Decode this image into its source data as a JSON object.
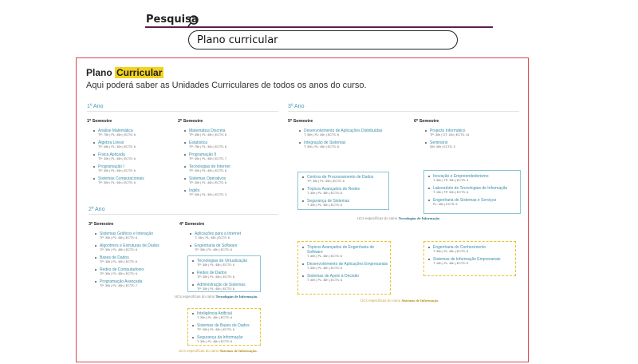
{
  "search": {
    "label": "Pesquisa",
    "value": "Plano curricular"
  },
  "page": {
    "title_plain": "Plano",
    "title_highlight": "Curricular",
    "subtitle": "Aqui poderá saber as Unidades Curriculares de todos os anos do curso."
  },
  "years": {
    "y1": "1º Ano",
    "y2": "2º Ano",
    "y3": "3º Ano"
  },
  "sem1": {
    "title": "1º Semestre",
    "items": [
      {
        "name": "Análise Matemática",
        "det": "TP: 75h | PL: 45h | ECTS: 6"
      },
      {
        "name": "Álgebra Linear",
        "det": "TP: 45h | PL: 30h | ECTS: 6"
      },
      {
        "name": "Física Aplicada",
        "det": "TP: 30h | PL: 45h | ECTS: 6"
      },
      {
        "name": "Programação I",
        "det": "TP: 30h | PL: 45h | ECTS: 6"
      },
      {
        "name": "Sistemas Computacionais",
        "det": "TP: 30h | PL: 45h | ECTS: 6"
      }
    ]
  },
  "sem2": {
    "title": "2º Semestre",
    "items": [
      {
        "name": "Matemática Discreta",
        "det": "TP: 45h | PL: 45h | ECTS: 6"
      },
      {
        "name": "Estatística",
        "det": "TP: 75h | PL: 30h | ECTS: 6"
      },
      {
        "name": "Programação II",
        "det": "TP: 30h | PL: 45h | ECTS: 7"
      },
      {
        "name": "Tecnologias de Internet",
        "det": "TP: 30h | PL: 45h | ECTS: 6"
      },
      {
        "name": "Sistemas Operativos",
        "det": "TP: 30h | PL: 45h | ECTS: 6"
      },
      {
        "name": "Inglês",
        "det": "TP: 30h | PL: 30h | ECTS: 3"
      }
    ]
  },
  "sem3": {
    "title": "3º Semestre",
    "items": [
      {
        "name": "Sistemas Gráficos e Interação",
        "det": "TP: 30h | PL: 45h | ECTS: 6"
      },
      {
        "name": "Algoritmos e Estruturas de Dados",
        "det": "TP: 30h | PL: 45h | ECTS: 6"
      },
      {
        "name": "Bases de Dados",
        "det": "TP: 30h | PL: 45h | ECTS: 6"
      },
      {
        "name": "Redes de Computadores",
        "det": "TP: 30h | PL: 45h | ECTS: 6"
      },
      {
        "name": "Programação Avançada",
        "det": "TP: 30h | PL: 45h | ECTS: 7"
      }
    ]
  },
  "sem4": {
    "title": "4º Semestre",
    "items": [
      {
        "name": "Aplicações para a Internet",
        "det": "T: 15h | PL: 45h | ECTS: 6"
      },
      {
        "name": "Engenharia de Software",
        "det": "TP: 30h | PL: 45h | ECTS: 6"
      }
    ],
    "ti": [
      {
        "name": "Tecnologias de Virtualização",
        "det": "TP: 30h | PL: 45h | ECTS: 6"
      },
      {
        "name": "Redes de Dados",
        "det": "TP: 30h | PL: 45h | ECTS: 6"
      },
      {
        "name": "Administração de Sistemas",
        "det": "TP: 30h | PL: 45h | ECTS: 6"
      }
    ],
    "ti_note_pre": "UCs específicas do ramo",
    "ti_note_branch": "Tecnologias de Informação.",
    "si": [
      {
        "name": "Inteligência Artificial",
        "det": "T: 30h | PL: 45h | ECTS: 6"
      },
      {
        "name": "Sistemas de Bases de Dados",
        "det": "TP: 30h | PL: 45h | ECTS: 6"
      },
      {
        "name": "Segurança da Informação",
        "det": "T: 30h | PL: 45h | ECTS: 6"
      }
    ],
    "si_note_pre": "UCs específicas do ramo",
    "si_note_branch": "Sistemas de Informação."
  },
  "sem5": {
    "title": "5º Semestre",
    "items": [
      {
        "name": "Desenvolvimento de Aplicações Distribuídas",
        "det": "T: 30h | PL: 45h | ECTS: 6"
      },
      {
        "name": "Integração de Sistemas",
        "det": "T: 30h | PL: 45h | ECTS: 6"
      }
    ],
    "ti": [
      {
        "name": "Centros de Processamento de Dados",
        "det": "TP: 30h | PL: 45h | ECTS: 6"
      },
      {
        "name": "Tópicos Avançados de Redes",
        "det": "T: 30h | PL: 45h | ECTS: 6"
      },
      {
        "name": "Segurança de Sistemas",
        "det": "T: 30h | PL: 45h | ECTS: 6"
      }
    ],
    "si": [
      {
        "name": "Tópicos Avançados de Engenharia de Software",
        "det": "T: 30h | PL: 45h | ECTS: 6"
      },
      {
        "name": "Desenvolvimento de Aplicações Empresariais",
        "det": "T: 30h | PL: 45h | ECTS: 6"
      },
      {
        "name": "Sistemas de Apoio à Decisão",
        "det": "T: 30h | PL: 45h | ECTS: 6"
      }
    ]
  },
  "sem6": {
    "title": "6º Semestre",
    "items": [
      {
        "name": "Projecto Informático",
        "det": "TP: 30h | OT: 15h | ECTS: 14"
      },
      {
        "name": "Seminário",
        "det": "SM: 30h | ECTS: 3"
      }
    ],
    "ti": [
      {
        "name": "Inovação e Empreendedorismo",
        "det": "T: 30h | TP: 30h | ECTS: 3"
      },
      {
        "name": "Laboratório de Tecnologias de Informação",
        "det": "T: 15h | TP: 60h | ECTS: 6"
      },
      {
        "name": "Engenharia de Sistemas e Serviços",
        "det": "PL: 45h | ECTS: 5"
      }
    ],
    "si": [
      {
        "name": "Engenharia do Conhecimento",
        "det": "T: 30h | PL: 45h | ECTS: 6"
      },
      {
        "name": "Sistemas de Informação Empresariais",
        "det": "T: 15h | PL: 45h | ECTS: 5"
      }
    ]
  },
  "y3_notes": {
    "ti_pre": "UCs específicas do ramo",
    "ti_branch": "Tecnologias de Informação",
    "si_pre": "UCs específicas do ramo",
    "si_branch": "Sistemas de Informação"
  }
}
